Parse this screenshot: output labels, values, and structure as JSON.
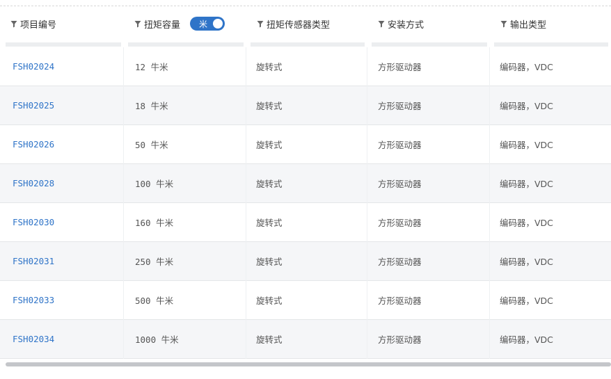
{
  "columns": [
    {
      "label": "项目编号"
    },
    {
      "label": "扭矩容量",
      "toggle_label": "米"
    },
    {
      "label": "扭矩传感器类型"
    },
    {
      "label": "安装方式"
    },
    {
      "label": "输出类型"
    }
  ],
  "rows": [
    {
      "id": "FSH02024",
      "capacity": "12 牛米",
      "sensor": "旋转式",
      "mount": "方形驱动器",
      "output": "编码器，VDC"
    },
    {
      "id": "FSH02025",
      "capacity": "18 牛米",
      "sensor": "旋转式",
      "mount": "方形驱动器",
      "output": "编码器，VDC"
    },
    {
      "id": "FSH02026",
      "capacity": "50 牛米",
      "sensor": "旋转式",
      "mount": "方形驱动器",
      "output": "编码器，VDC"
    },
    {
      "id": "FSH02028",
      "capacity": "100 牛米",
      "sensor": "旋转式",
      "mount": "方形驱动器",
      "output": "编码器，VDC"
    },
    {
      "id": "FSH02030",
      "capacity": "160 牛米",
      "sensor": "旋转式",
      "mount": "方形驱动器",
      "output": "编码器，VDC"
    },
    {
      "id": "FSH02031",
      "capacity": "250 牛米",
      "sensor": "旋转式",
      "mount": "方形驱动器",
      "output": "编码器，VDC"
    },
    {
      "id": "FSH02033",
      "capacity": "500 牛米",
      "sensor": "旋转式",
      "mount": "方形驱动器",
      "output": "编码器，VDC"
    },
    {
      "id": "FSH02034",
      "capacity": "1000 牛米",
      "sensor": "旋转式",
      "mount": "方形驱动器",
      "output": "编码器，VDC"
    }
  ],
  "colors": {
    "link": "#2f74c8",
    "toggle_on": "#2f74c8",
    "row_alt": "#f5f6f8"
  },
  "icons": {
    "column_filter": "filter-icon",
    "unit_toggle": "toggle-switch"
  }
}
